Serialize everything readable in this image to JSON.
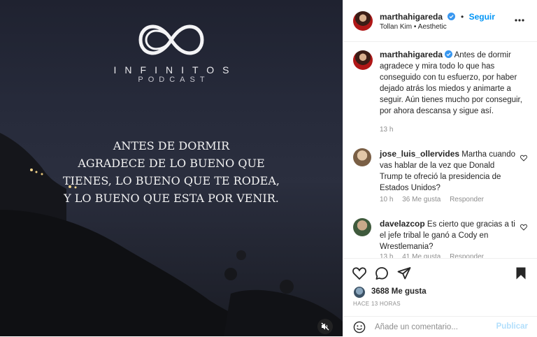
{
  "media": {
    "brand_name": "INFINITOS",
    "brand_sub": "PODCAST",
    "quote_lines": [
      "ANTES DE DORMIR",
      "AGRADECE DE LO BUENO QUE",
      "TIENES, LO BUENO QUE TE RODEA,",
      "Y LO BUENO QUE ESTA POR VENIR."
    ],
    "mute_icon": "speaker-muted-icon"
  },
  "header": {
    "username": "marthahigareda",
    "dot": "•",
    "follow_label": "Seguir",
    "audio": "Tollan Kim",
    "audio_sep": "•",
    "audio_track": "Aesthetic"
  },
  "caption": {
    "username": "marthahigareda",
    "text": "Antes de dormir agradece y mira todo lo que has conseguido con tu esfuerzo, por haber dejado atrás los miedos y animarte a seguir. Aún tienes mucho por conseguir, por ahora descansa y sigue así.",
    "time": "13 h"
  },
  "comments": [
    {
      "username": "jose_luis_ollervides",
      "text": "Martha cuando vas hablar de la vez que Donald Trump te ofreció la presidencia de Estados Unidos?",
      "time": "10 h",
      "likes": "36 Me gusta",
      "reply": "Responder"
    },
    {
      "username": "davelazcop",
      "text": "Es cierto que gracias a ti el jefe tribal le ganó a Cody en Wrestlemania?",
      "time": "13 h",
      "likes": "41 Me gusta",
      "reply": "Responder"
    }
  ],
  "actions": {
    "likes_count": "3688 Me gusta",
    "ago": "HACE 13 HORAS",
    "comment_placeholder": "Añade un comentario...",
    "post_label": "Publicar"
  },
  "colors": {
    "accent": "#0095f6",
    "muted": "#8e8e8e",
    "verified": "#3897f0"
  }
}
